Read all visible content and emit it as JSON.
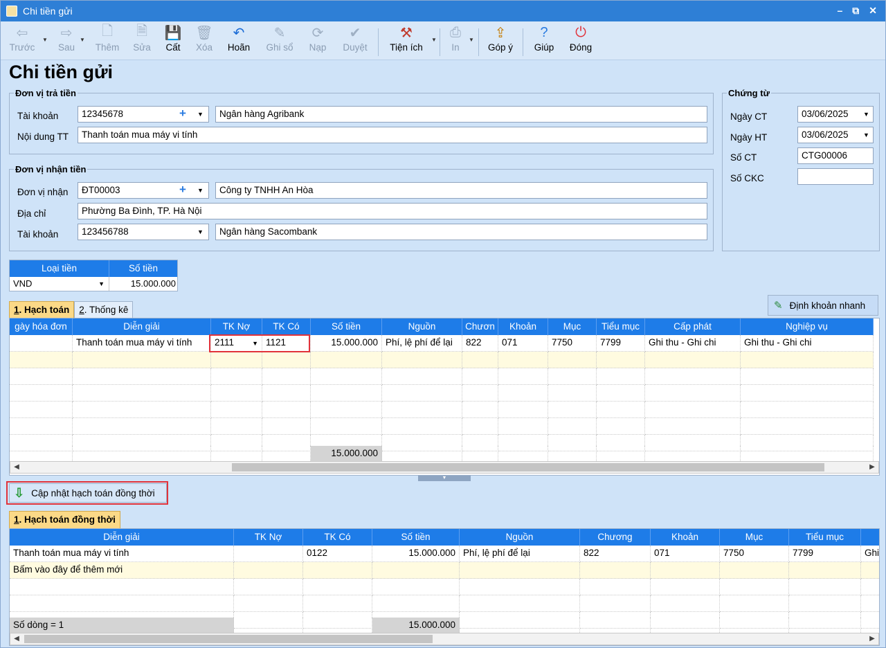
{
  "window": {
    "title": "Chi tiền gửi",
    "minimize": "–",
    "restore": "⧉",
    "close": "✕"
  },
  "toolbar": {
    "prev": "Trước",
    "next": "Sau",
    "add": "Thêm",
    "edit": "Sửa",
    "save": "Cất",
    "delete": "Xóa",
    "undo": "Hoãn",
    "post": "Ghi sổ",
    "reload": "Nạp",
    "approve": "Duyệt",
    "utilities": "Tiện ích",
    "print": "In",
    "feedback": "Góp ý",
    "help": "Giúp",
    "close": "Đóng"
  },
  "page_title": "Chi tiền gửi",
  "payer": {
    "legend": "Đơn vị trả tiền",
    "account_label": "Tài khoản",
    "account": "12345678",
    "bank": "Ngân hàng Agribank",
    "content_label": "Nội dung TT",
    "content": "Thanh toán mua máy vi tính"
  },
  "payee": {
    "legend": "Đơn vị nhận tiền",
    "unit_label": "Đơn vị nhận",
    "unit": "ĐT00003",
    "unit_name": "Công ty TNHH An Hòa",
    "address_label": "Địa chỉ",
    "address": "Phường Ba Đình, TP. Hà Nội",
    "account_label": "Tài khoản",
    "account": "123456788",
    "bank": "Ngân hàng Sacombank"
  },
  "voucher": {
    "legend": "Chứng từ",
    "date_ct_label": "Ngày CT",
    "date_ct": "03/06/2025",
    "date_ht_label": "Ngày HT",
    "date_ht": "03/06/2025",
    "number_label": "Số CT",
    "number": "CTG00006",
    "ckc_label": "Số CKC",
    "ckc": ""
  },
  "money": {
    "currency_label": "Loại tiền",
    "amount_label": "Số tiền",
    "currency": "VND",
    "amount": "15.000.000"
  },
  "tabs_top": {
    "tab1_num": "1",
    "tab1": ". Hạch toán",
    "tab2_num": "2",
    "tab2": ". Thống kê"
  },
  "quick_button": "Định khoản nhanh",
  "grid1": {
    "headers": [
      "gày hóa đơn",
      "Diễn giải",
      "TK Nợ",
      "TK Có",
      "Số tiền",
      "Nguồn",
      "Chươn",
      "Khoản",
      "Mục",
      "Tiểu mục",
      "Cấp phát",
      "Nghiệp vụ"
    ],
    "row": [
      "",
      "Thanh toán mua máy vi tính",
      "2111",
      "1121",
      "15.000.000",
      "Phí, lệ phí để lại",
      "822",
      "071",
      "7750",
      "7799",
      "Ghi thu - Ghi chi",
      "Ghi thu - Ghi chi"
    ],
    "total": "15.000.000"
  },
  "update_button": "Cập nhật hạch toán đồng thời",
  "tabs_bottom": {
    "tab1_num": "1",
    "tab1": ". Hạch toán đồng thời"
  },
  "grid2": {
    "headers": [
      "Diễn giải",
      "TK Nợ",
      "TK Có",
      "Số tiền",
      "Nguồn",
      "Chương",
      "Khoản",
      "Mục",
      "Tiểu mục",
      ""
    ],
    "row": [
      "Thanh toán mua máy vi tính",
      "",
      "0122",
      "15.000.000",
      "Phí, lệ phí để lại",
      "822",
      "071",
      "7750",
      "7799",
      "Ghi"
    ],
    "add_row": "Bấm vào đây để thêm mới",
    "footer_count": "Số dòng = 1",
    "total": "15.000.000"
  }
}
